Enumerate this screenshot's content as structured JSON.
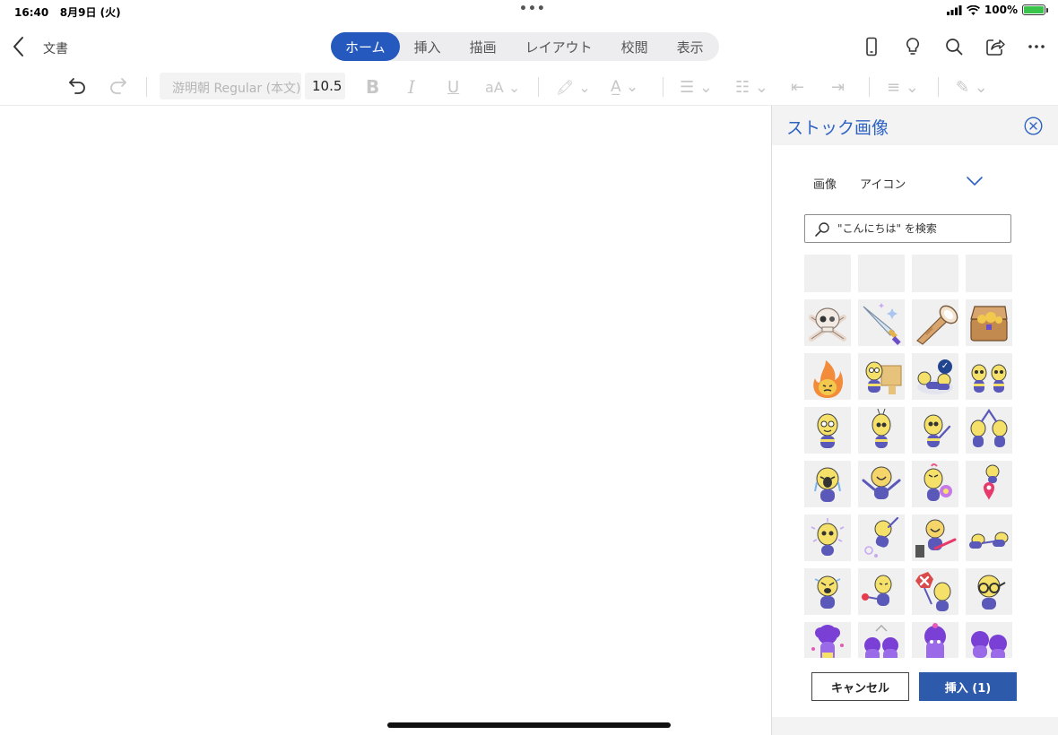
{
  "status_bar": {
    "time": "16:40",
    "date": "8月9日 (火)",
    "battery": "100%"
  },
  "header": {
    "doc_title": "文書",
    "tabs": [
      {
        "label": "ホーム",
        "active": true
      },
      {
        "label": "挿入"
      },
      {
        "label": "描画"
      },
      {
        "label": "レイアウト"
      },
      {
        "label": "校閲"
      },
      {
        "label": "表示"
      }
    ]
  },
  "toolbar": {
    "font_name": "游明朝 Regular (本文)",
    "font_size": "10.5"
  },
  "panel": {
    "title": "ストック画像",
    "filter_label": "画像",
    "filter_value": "アイコン",
    "search_placeholder": "\"こんにちは\" を検索",
    "cancel_label": "キャンセル",
    "insert_label": "挿入 (1)",
    "selected_tile": "bees-fighting"
  },
  "colors": {
    "accent": "#2659be",
    "panel_title": "#2e63c2",
    "insert_button": "#2e5aac",
    "check": "#21458e"
  }
}
